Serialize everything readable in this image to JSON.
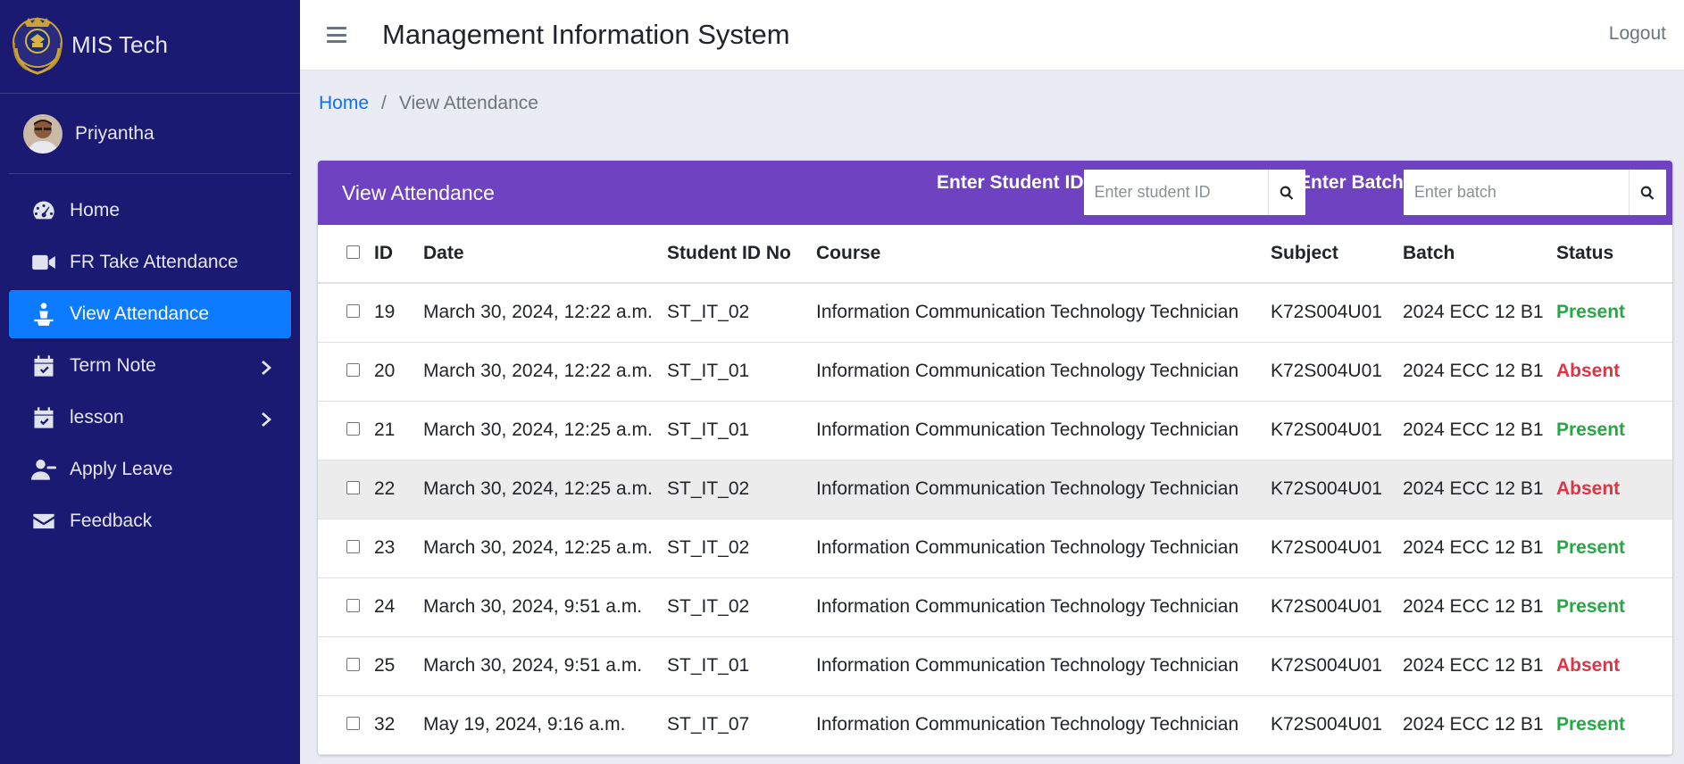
{
  "brand": {
    "name": "MIS Tech",
    "logo": "college-crest-logo"
  },
  "user": {
    "name": "Priyantha"
  },
  "sidebar": {
    "items": [
      {
        "label": "Home",
        "icon": "tachometer-icon"
      },
      {
        "label": "FR Take Attendance",
        "icon": "video-camera-icon"
      },
      {
        "label": "View Attendance",
        "icon": "person-podium-icon",
        "active": true
      },
      {
        "label": "Term Note",
        "icon": "calendar-check-icon",
        "has_submenu": true
      },
      {
        "label": "lesson",
        "icon": "calendar-check-icon",
        "has_submenu": true
      },
      {
        "label": "Apply Leave",
        "icon": "user-minus-icon"
      },
      {
        "label": "Feedback",
        "icon": "envelope-icon"
      }
    ]
  },
  "header": {
    "title": "Management Information System",
    "logout": "Logout"
  },
  "breadcrumb": {
    "home": "Home",
    "separator": "/",
    "current": "View Attendance"
  },
  "card": {
    "title": "View Attendance",
    "student_filter": {
      "label": "Enter Student ID",
      "placeholder": "Enter student ID"
    },
    "batch_filter": {
      "label": "Enter Batch",
      "placeholder": "Enter batch"
    }
  },
  "table": {
    "columns": [
      "ID",
      "Date",
      "Student ID No",
      "Course",
      "Subject",
      "Batch",
      "Status"
    ],
    "rows": [
      {
        "id": "19",
        "date": "March 30, 2024, 12:22 a.m.",
        "student_id": "ST_IT_02",
        "course": "Information Communication Technology Technician",
        "subject": "K72S004U01",
        "batch": "2024 ECC 12 B1",
        "status": "Present"
      },
      {
        "id": "20",
        "date": "March 30, 2024, 12:22 a.m.",
        "student_id": "ST_IT_01",
        "course": "Information Communication Technology Technician",
        "subject": "K72S004U01",
        "batch": "2024 ECC 12 B1",
        "status": "Absent"
      },
      {
        "id": "21",
        "date": "March 30, 2024, 12:25 a.m.",
        "student_id": "ST_IT_01",
        "course": "Information Communication Technology Technician",
        "subject": "K72S004U01",
        "batch": "2024 ECC 12 B1",
        "status": "Present"
      },
      {
        "id": "22",
        "date": "March 30, 2024, 12:25 a.m.",
        "student_id": "ST_IT_02",
        "course": "Information Communication Technology Technician",
        "subject": "K72S004U01",
        "batch": "2024 ECC 12 B1",
        "status": "Absent"
      },
      {
        "id": "23",
        "date": "March 30, 2024, 12:25 a.m.",
        "student_id": "ST_IT_02",
        "course": "Information Communication Technology Technician",
        "subject": "K72S004U01",
        "batch": "2024 ECC 12 B1",
        "status": "Present"
      },
      {
        "id": "24",
        "date": "March 30, 2024, 9:51 a.m.",
        "student_id": "ST_IT_02",
        "course": "Information Communication Technology Technician",
        "subject": "K72S004U01",
        "batch": "2024 ECC 12 B1",
        "status": "Present"
      },
      {
        "id": "25",
        "date": "March 30, 2024, 9:51 a.m.",
        "student_id": "ST_IT_01",
        "course": "Information Communication Technology Technician",
        "subject": "K72S004U01",
        "batch": "2024 ECC 12 B1",
        "status": "Absent"
      },
      {
        "id": "32",
        "date": "May 19, 2024, 9:16 a.m.",
        "student_id": "ST_IT_07",
        "course": "Information Communication Technology Technician",
        "subject": "K72S004U01",
        "batch": "2024 ECC 12 B1",
        "status": "Present"
      }
    ]
  },
  "colors": {
    "sidebar_bg": "#1a1a72",
    "active_item": "#0d7bff",
    "card_header": "#6f42c1",
    "present": "#28a745",
    "absent": "#dc3545",
    "link": "#0d6efd"
  }
}
